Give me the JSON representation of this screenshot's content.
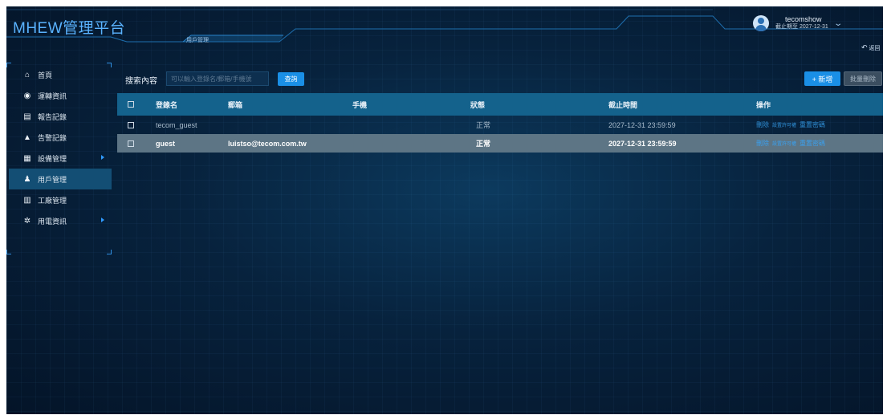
{
  "app": {
    "title": "MHEW管理平台"
  },
  "header": {
    "page_tab": "用戶管理",
    "user": {
      "name": "tecomshow",
      "expiry": "截止期至 2027-12-31"
    },
    "back_label": "返回"
  },
  "sidebar": {
    "items": [
      {
        "label": "首頁",
        "icon": "home-icon",
        "glyph": "⌂"
      },
      {
        "label": "運轉資訊",
        "icon": "target-icon",
        "glyph": "◉"
      },
      {
        "label": "報告記錄",
        "icon": "report-icon",
        "glyph": "▤"
      },
      {
        "label": "告警記錄",
        "icon": "bell-icon",
        "glyph": "▲"
      },
      {
        "label": "設備管理",
        "icon": "grid-icon",
        "glyph": "▦"
      },
      {
        "label": "用戶管理",
        "icon": "user-icon",
        "glyph": "♟"
      },
      {
        "label": "工廠管理",
        "icon": "factory-icon",
        "glyph": "▥"
      },
      {
        "label": "用電資訊",
        "icon": "gear-icon",
        "glyph": "✲"
      }
    ]
  },
  "toolbar": {
    "search_label": "搜索內容",
    "search_placeholder": "可以輸入登錄名/郵箱/手機號",
    "query_label": "查詢",
    "add_label": "+ 新增",
    "batch_delete_label": "批量刪除"
  },
  "table": {
    "columns": [
      "登錄名",
      "郵箱",
      "手機",
      "狀態",
      "截止時間",
      "操作"
    ],
    "rows": [
      {
        "login": "tecom_guest",
        "email": "",
        "phone": "",
        "status": "正常",
        "expiry": "2027-12-31 23:59:59",
        "selected": false
      },
      {
        "login": "guest",
        "email": "luistso@tecom.com.tw",
        "phone": "",
        "status": "正常",
        "expiry": "2027-12-31 23:59:59",
        "selected": true
      }
    ],
    "actions": {
      "delete": "刪除",
      "permissions": "設置許可權",
      "reset": "重置密碼"
    }
  },
  "colors": {
    "accent": "#1a8fe6",
    "header_row": "#14628c",
    "selected_row": "#5d7585",
    "active_nav": "#134e74"
  }
}
